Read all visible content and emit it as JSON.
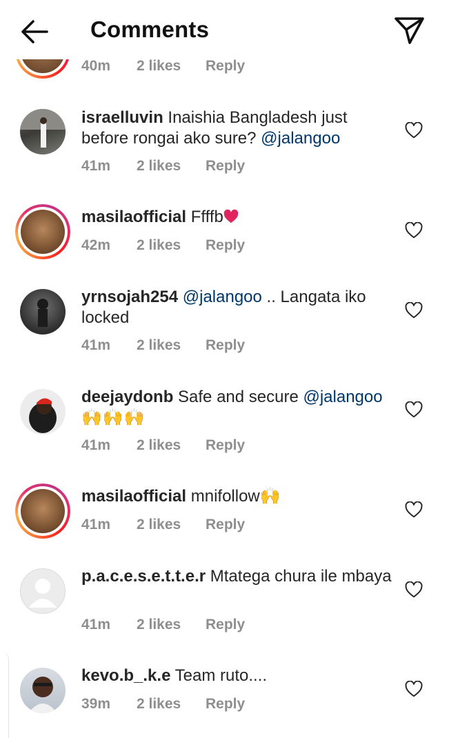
{
  "header": {
    "title": "Comments",
    "back_icon": "arrow-left-icon",
    "share_icon": "paper-plane-icon"
  },
  "partial_comment": {
    "time": "40m",
    "likes": "2 likes",
    "reply": "Reply"
  },
  "comments": [
    {
      "username": "israelluvin",
      "text_1": " Inaishia Bangladesh  just before rongai ako sure? ",
      "mention": "@jalangoo",
      "time": "41m",
      "likes": "2 likes",
      "reply": "Reply"
    },
    {
      "username": "masilaofficial",
      "text_1": " Ffffb",
      "emoji": "❤️",
      "time": "42m",
      "likes": "2 likes",
      "reply": "Reply"
    },
    {
      "username": "yrnsojah254",
      "mention": "@jalangoo",
      "text_1": " .. Langata iko locked",
      "time": "41m",
      "likes": "2 likes",
      "reply": "Reply"
    },
    {
      "username": "deejaydonb",
      "text_1": " Safe and secure ",
      "mention": "@jalangoo",
      "emoji": "🙌🙌🙌",
      "time": "41m",
      "likes": "2 likes",
      "reply": "Reply"
    },
    {
      "username": "masilaofficial",
      "text_1": " mnifollow",
      "emoji": "🙌",
      "time": "41m",
      "likes": "2 likes",
      "reply": "Reply"
    },
    {
      "username": "p.a.c.e.s.e.t.t.e.r",
      "text_1": " Mtatega chura ile mbaya",
      "time": "41m",
      "likes": "2 likes",
      "reply": "Reply"
    },
    {
      "username": "kevo.b_.k.e",
      "text_1": " Team ruto....",
      "time": "39m",
      "likes": "2 likes",
      "reply": "Reply"
    }
  ],
  "colors": {
    "text": "#262626",
    "meta": "#8e8e8e",
    "mention": "#00376b",
    "heart_red": "#e0245e"
  }
}
